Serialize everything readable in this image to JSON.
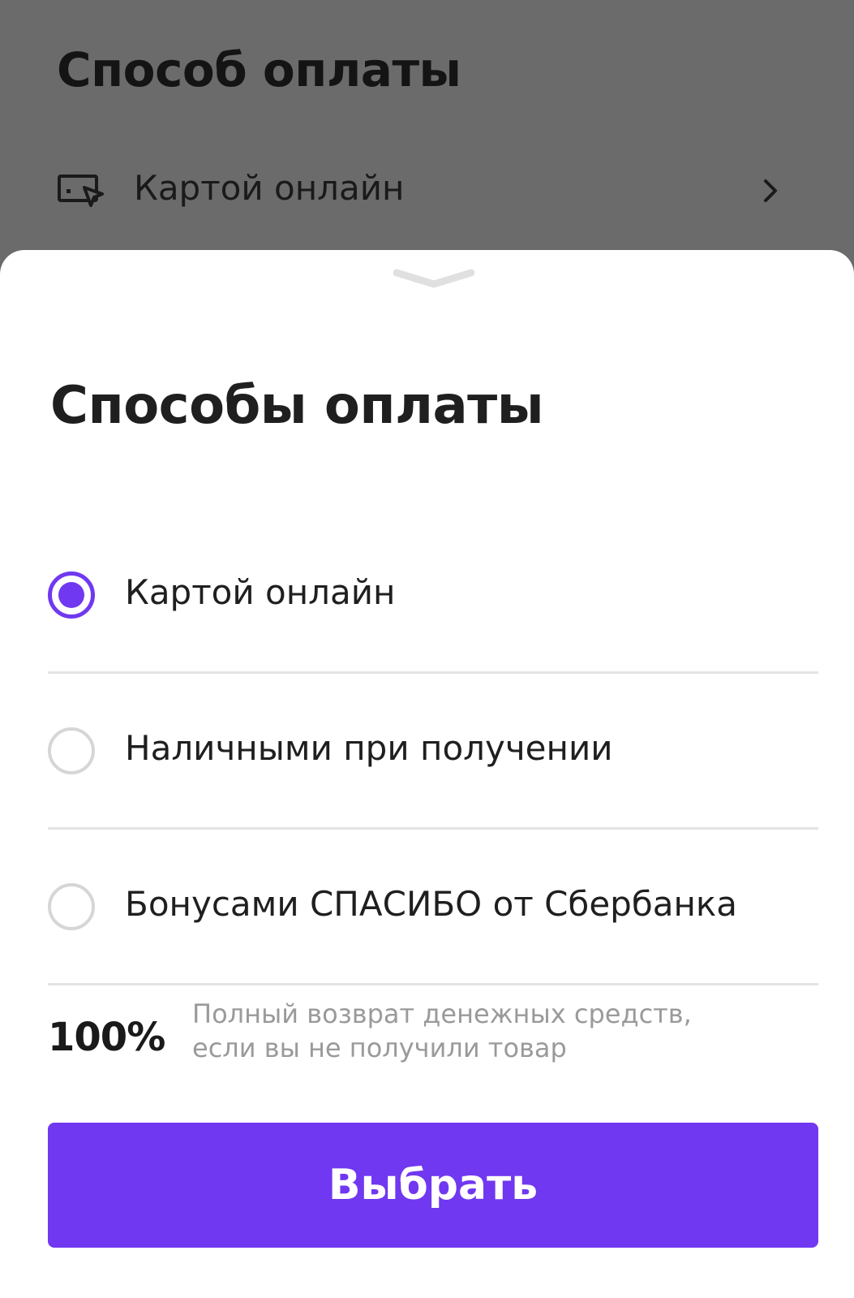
{
  "colors": {
    "accent": "#7038f0",
    "overlay": "#6b6b6b",
    "divider": "#e3e3e3",
    "muted_text": "#9a9a9a"
  },
  "background_page": {
    "title": "Способ оплаты",
    "selected_method": {
      "icon": "card-online-icon",
      "label": "Картой онлайн",
      "chevron": "chevron-right-icon"
    }
  },
  "sheet": {
    "handle_icon": "chevron-down-icon",
    "title": "Способы оплаты",
    "options": [
      {
        "label": "Картой онлайн",
        "selected": true
      },
      {
        "label": "Наличными при получении",
        "selected": false
      },
      {
        "label": "Бонусами СПАСИБО от Сбербанка",
        "selected": false
      }
    ],
    "guarantee": {
      "percent": "100%",
      "line1": "Полный возврат денежных средств,",
      "line2": "если вы не получили товар"
    },
    "button_label": "Выбрать"
  }
}
